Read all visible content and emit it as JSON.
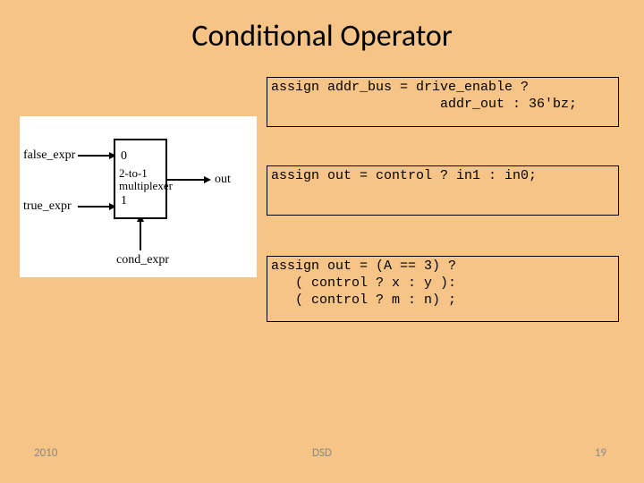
{
  "title": "Conditional Operator",
  "diagram": {
    "false_label": "false_expr",
    "true_label": "true_expr",
    "out_label": "out",
    "cond_label": "cond_expr",
    "port0": "0",
    "port1": "1",
    "mux_label_line1": "2-to-1",
    "mux_label_line2": "multiplexer"
  },
  "code1": "assign addr_bus = drive_enable ?\n                     addr_out : 36'bz;",
  "code2": "assign out = control ? in1 : in0;",
  "code3": "assign out = (A == 3) ?\n   ( control ? x : y ):\n   ( control ? m : n) ;",
  "footer": {
    "year": "2010",
    "center": "DSD",
    "page": "19"
  }
}
